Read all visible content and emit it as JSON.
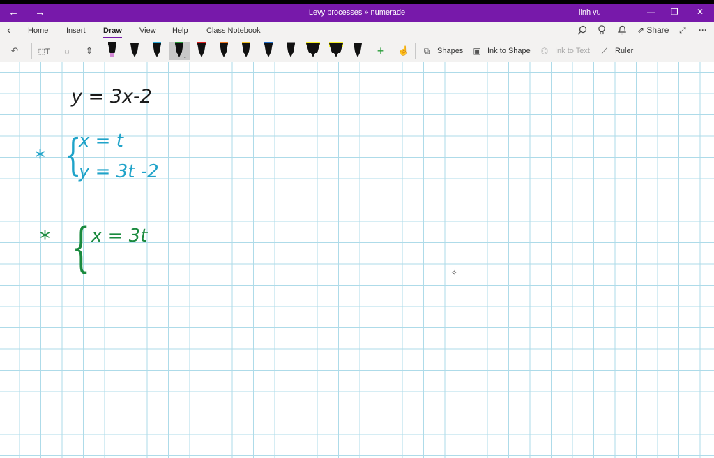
{
  "titlebar": {
    "title": "Levy processes » numerade",
    "user": "linh vu",
    "back_icon": "←",
    "forward_icon": "→",
    "minimize_icon": "—",
    "restore_icon": "❐",
    "close_icon": "✕"
  },
  "tabs": [
    "Home",
    "Insert",
    "Draw",
    "View",
    "Help",
    "Class Notebook"
  ],
  "active_tab": "Draw",
  "right_actions": {
    "share_label": "Share",
    "more_icon": "···"
  },
  "tools": {
    "shapes_label": "Shapes",
    "ink_to_shape_label": "Ink to Shape",
    "ink_to_text_label": "Ink to Text",
    "ruler_label": "Ruler"
  },
  "pens": [
    {
      "tip": "#d48ad6",
      "cap": "#111"
    },
    {
      "tip": "#111",
      "cap": "#111"
    },
    {
      "tip": "#28a8d8",
      "cap": "#111"
    },
    {
      "tip": "#2a9d3a",
      "cap": "#2a9d3a"
    },
    {
      "tip": "#e02020",
      "cap": "#e02020"
    },
    {
      "tip": "#f07820",
      "cap": "#f07820"
    },
    {
      "tip": "#f0c020",
      "cap": "#f0c020"
    },
    {
      "tip": "#1e6cc8",
      "cap": "#1e6cc8"
    },
    {
      "tip": "#888",
      "cap": "#888"
    },
    {
      "tip": "#f5ef2a",
      "cap": "#f5ef2a"
    },
    {
      "tip": "#f5ef2a",
      "cap": "#f5ef2a"
    },
    {
      "tip": "#111",
      "cap": "#111"
    }
  ],
  "colors": {
    "accent": "#7719aa",
    "grid": "#aedbe9",
    "ink_black": "#1a1a1a",
    "ink_blue": "#1fa3c9",
    "ink_green": "#1a8a3e"
  },
  "ink": {
    "line1": "y =  3x-2",
    "star1": "*",
    "brace1": "{",
    "line2": "x = t",
    "line3": "y = 3t -2",
    "star2": "*",
    "brace2": "{",
    "line4": "x =   3t"
  }
}
